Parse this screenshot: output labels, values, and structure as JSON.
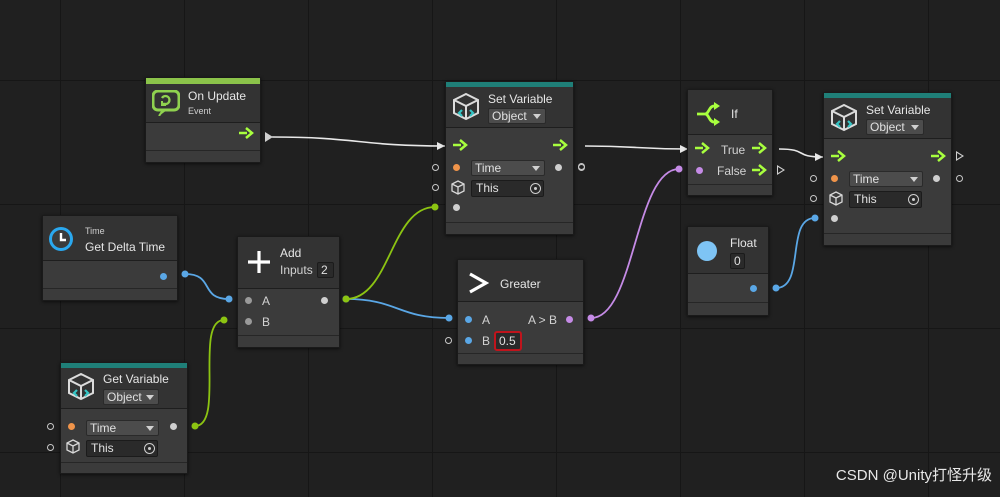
{
  "colors": {
    "event_bar": "#8bc34a",
    "unit_bar": "#1f7f78",
    "flow": "#a8ff3e",
    "time_wire": "#5aa7e6",
    "object_wire": "#8cc412",
    "bool_wire": "#c58be6",
    "flow_wire": "#e8e8e8",
    "highlight": "#c0141c"
  },
  "nodes": {
    "on_update": {
      "title": "On Update",
      "subtitle": "Event",
      "icon": "on-update-loop-icon"
    },
    "get_delta_time": {
      "subtitle": "Time",
      "title": "Get Delta Time",
      "icon": "clock-icon"
    },
    "add": {
      "title": "Add",
      "inputs_label": "Inputs",
      "inputs_value": "2",
      "port_a": "A",
      "port_b": "B",
      "icon": "plus-icon"
    },
    "get_variable": {
      "title": "Get Variable",
      "kind": "Object",
      "name": "Time",
      "target": "This",
      "icon": "variable-cube-icon"
    },
    "set_variable_1": {
      "title": "Set Variable",
      "kind": "Object",
      "name": "Time",
      "target": "This",
      "icon": "variable-cube-icon"
    },
    "greater": {
      "title": "Greater",
      "port_a": "A",
      "port_b": "B",
      "b_value": "0.5",
      "output": "A > B",
      "icon": "greater-than-icon"
    },
    "if": {
      "title": "If",
      "true_label": "True",
      "false_label": "False",
      "icon": "branch-icon"
    },
    "float": {
      "title": "Float",
      "value": "0",
      "icon": "float-circle-icon"
    },
    "set_variable_2": {
      "title": "Set Variable",
      "kind": "Object",
      "name": "Time",
      "target": "This",
      "icon": "variable-cube-icon"
    }
  },
  "watermark": "CSDN @Unity打怪升级"
}
